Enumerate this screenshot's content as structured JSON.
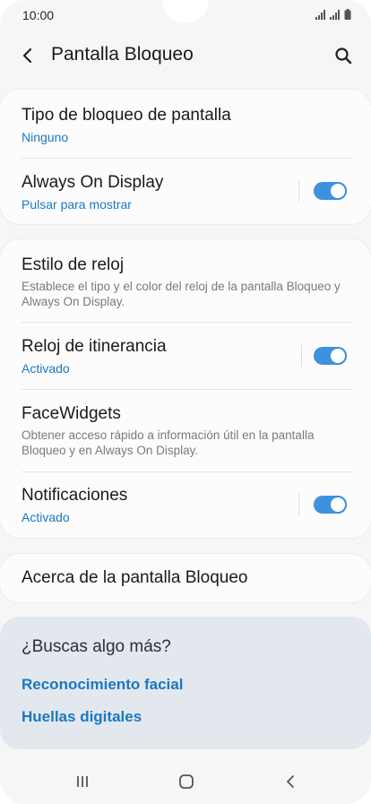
{
  "status_bar": {
    "time": "10:00",
    "icons": [
      "signal-icon",
      "signal-icon",
      "battery-icon"
    ]
  },
  "header": {
    "title": "Pantalla Bloqueo",
    "back_icon": "chevron-left-icon",
    "search_icon": "search-icon"
  },
  "section1": {
    "items": [
      {
        "title": "Tipo de bloqueo de pantalla",
        "subtitle": "Ninguno"
      },
      {
        "title": "Always On Display",
        "subtitle": "Pulsar para mostrar",
        "toggle": true
      }
    ]
  },
  "section2": {
    "items": [
      {
        "title": "Estilo de reloj",
        "description": "Establece el tipo y el color del reloj de la pantalla Bloqueo y Always On Display."
      },
      {
        "title": "Reloj de itinerancia",
        "subtitle": "Activado",
        "toggle": true
      },
      {
        "title": "FaceWidgets",
        "description": "Obtener acceso rápido a información útil en la pantalla Bloqueo y en Always On Display."
      },
      {
        "title": "Notificaciones",
        "subtitle": "Activado",
        "toggle": true
      }
    ]
  },
  "section3": {
    "items": [
      {
        "title": "Acerca de la pantalla Bloqueo"
      }
    ]
  },
  "suggestions": {
    "title": "¿Buscas algo más?",
    "links": [
      "Reconocimiento facial",
      "Huellas digitales"
    ]
  },
  "nav_bar": {
    "icons": [
      "recent-apps-icon",
      "home-icon",
      "back-icon"
    ]
  },
  "colors": {
    "accent": "#1a78c2",
    "toggle_on": "#3e91dd",
    "background": "#f6f6f6",
    "suggestion_bg": "#e3e8ef"
  }
}
